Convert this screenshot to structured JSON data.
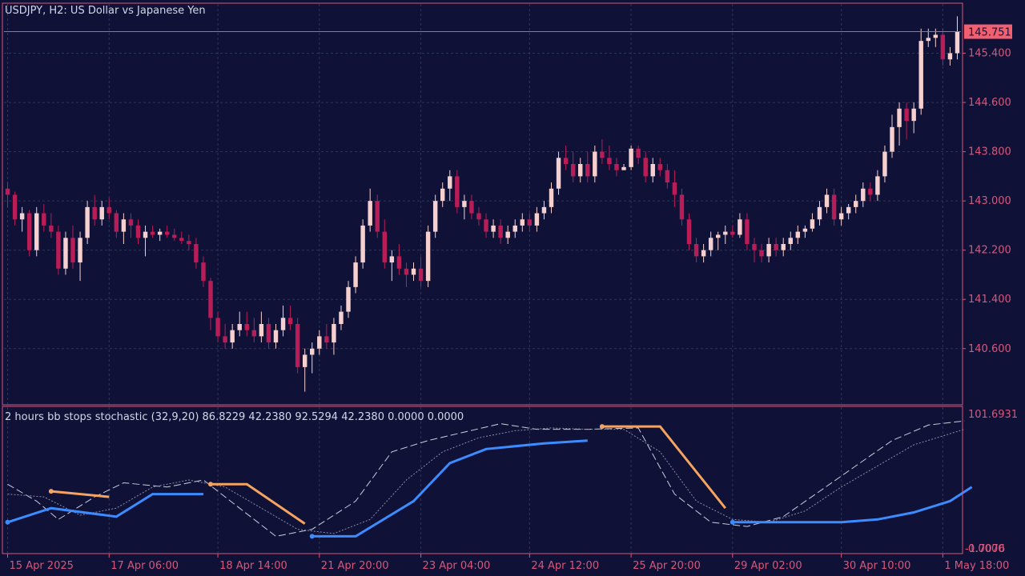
{
  "colors": {
    "background": "#0f1137",
    "frame": "#d8577a",
    "grid": "#2a3a55",
    "text": "#d8577a",
    "header_text": "#d0d8e8",
    "bull": "#f5d0cf",
    "bear": "#b81d57",
    "price_tag_bg": "#f06070",
    "price_tag_text": "#0f1137",
    "stop_up": "#3c8cff",
    "stop_down": "#f4a460",
    "stoch_main": "#c8d0dc",
    "stoch_signal": "#8a90a6"
  },
  "chart_data": [
    {
      "type": "candlestick",
      "title": "USDJPY, H2:  US Dollar vs Japanese Yen",
      "symbol": "USDJPY",
      "timeframe": "H2",
      "description": "US Dollar vs Japanese Yen",
      "current_price_label": "145.751",
      "current_price": 145.751,
      "ylim": [
        139.7,
        146.2
      ],
      "yticks": [
        140.6,
        141.4,
        142.2,
        143.0,
        143.8,
        144.6,
        145.4
      ],
      "ytick_labels": [
        "140.600",
        "141.400",
        "142.200",
        "143.000",
        "143.800",
        "144.600",
        "145.400"
      ],
      "grid": true,
      "candles": [
        [
          143.2,
          143.3,
          142.9,
          143.1
        ],
        [
          143.1,
          143.15,
          142.6,
          142.7
        ],
        [
          142.7,
          142.9,
          142.5,
          142.8
        ],
        [
          142.8,
          142.85,
          142.1,
          142.2
        ],
        [
          142.2,
          142.9,
          142.1,
          142.8
        ],
        [
          142.8,
          142.95,
          142.5,
          142.6
        ],
        [
          142.6,
          142.8,
          142.4,
          142.5
        ],
        [
          142.5,
          142.6,
          141.8,
          141.9
        ],
        [
          141.9,
          142.5,
          141.8,
          142.4
        ],
        [
          142.4,
          142.6,
          141.9,
          142.0
        ],
        [
          142.0,
          142.5,
          141.7,
          142.4
        ],
        [
          142.4,
          143.0,
          142.3,
          142.9
        ],
        [
          142.9,
          143.1,
          142.6,
          142.7
        ],
        [
          142.7,
          143.0,
          142.6,
          142.9
        ],
        [
          142.9,
          143.05,
          142.7,
          142.8
        ],
        [
          142.8,
          142.85,
          142.4,
          142.5
        ],
        [
          142.5,
          142.8,
          142.3,
          142.7
        ],
        [
          142.7,
          142.8,
          142.4,
          142.6
        ],
        [
          142.6,
          142.7,
          142.3,
          142.4
        ],
        [
          142.4,
          142.6,
          142.1,
          142.5
        ],
        [
          142.5,
          142.6,
          142.4,
          142.45
        ],
        [
          142.45,
          142.55,
          142.35,
          142.5
        ],
        [
          142.5,
          142.6,
          142.4,
          142.45
        ],
        [
          142.45,
          142.55,
          142.35,
          142.4
        ],
        [
          142.4,
          142.5,
          142.3,
          142.35
        ],
        [
          142.35,
          142.45,
          142.2,
          142.3
        ],
        [
          142.3,
          142.4,
          141.9,
          142.0
        ],
        [
          142.0,
          142.1,
          141.6,
          141.7
        ],
        [
          141.7,
          141.75,
          140.9,
          141.1
        ],
        [
          141.1,
          141.2,
          140.7,
          140.8
        ],
        [
          140.8,
          141.0,
          140.6,
          140.7
        ],
        [
          140.7,
          141.0,
          140.6,
          140.9
        ],
        [
          140.9,
          141.2,
          140.8,
          141.0
        ],
        [
          141.0,
          141.2,
          140.8,
          140.9
        ],
        [
          140.9,
          141.1,
          140.7,
          140.8
        ],
        [
          140.8,
          141.2,
          140.7,
          141.0
        ],
        [
          141.0,
          141.1,
          140.6,
          140.7
        ],
        [
          140.7,
          141.0,
          140.6,
          140.9
        ],
        [
          140.9,
          141.3,
          140.8,
          141.1
        ],
        [
          141.1,
          141.3,
          140.9,
          141.0
        ],
        [
          141.0,
          141.1,
          140.2,
          140.3
        ],
        [
          140.3,
          140.6,
          139.9,
          140.5
        ],
        [
          140.5,
          140.7,
          140.2,
          140.6
        ],
        [
          140.6,
          140.9,
          140.5,
          140.8
        ],
        [
          140.8,
          141.0,
          140.6,
          140.7
        ],
        [
          140.7,
          141.1,
          140.5,
          141.0
        ],
        [
          141.0,
          141.3,
          140.9,
          141.2
        ],
        [
          141.2,
          141.7,
          141.1,
          141.6
        ],
        [
          141.6,
          142.1,
          141.5,
          142.0
        ],
        [
          142.0,
          142.7,
          141.9,
          142.6
        ],
        [
          142.6,
          143.2,
          142.5,
          143.0
        ],
        [
          143.0,
          143.1,
          142.4,
          142.5
        ],
        [
          142.5,
          142.7,
          141.9,
          142.0
        ],
        [
          142.0,
          142.2,
          141.7,
          142.1
        ],
        [
          142.1,
          142.3,
          141.8,
          141.9
        ],
        [
          141.9,
          142.0,
          141.6,
          141.8
        ],
        [
          141.8,
          142.0,
          141.7,
          141.9
        ],
        [
          141.9,
          142.1,
          141.6,
          141.7
        ],
        [
          141.7,
          142.6,
          141.6,
          142.5
        ],
        [
          142.5,
          143.1,
          142.4,
          143.0
        ],
        [
          143.0,
          143.3,
          142.9,
          143.2
        ],
        [
          143.2,
          143.5,
          143.0,
          143.4
        ],
        [
          143.4,
          143.5,
          142.8,
          142.9
        ],
        [
          142.9,
          143.1,
          142.7,
          143.0
        ],
        [
          143.0,
          143.1,
          142.7,
          142.8
        ],
        [
          142.8,
          142.9,
          142.6,
          142.7
        ],
        [
          142.7,
          142.8,
          142.4,
          142.5
        ],
        [
          142.5,
          142.7,
          142.4,
          142.6
        ],
        [
          142.6,
          142.7,
          142.3,
          142.4
        ],
        [
          142.4,
          142.6,
          142.3,
          142.5
        ],
        [
          142.5,
          142.7,
          142.4,
          142.6
        ],
        [
          142.6,
          142.8,
          142.5,
          142.7
        ],
        [
          142.7,
          142.8,
          142.5,
          142.6
        ],
        [
          142.6,
          142.9,
          142.5,
          142.8
        ],
        [
          142.8,
          143.0,
          142.7,
          142.9
        ],
        [
          142.9,
          143.3,
          142.8,
          143.2
        ],
        [
          143.2,
          143.8,
          143.1,
          143.7
        ],
        [
          143.7,
          143.9,
          143.5,
          143.6
        ],
        [
          143.6,
          143.8,
          143.3,
          143.4
        ],
        [
          143.4,
          143.7,
          143.3,
          143.6
        ],
        [
          143.6,
          143.8,
          143.3,
          143.4
        ],
        [
          143.4,
          143.9,
          143.3,
          143.8
        ],
        [
          143.8,
          144.0,
          143.6,
          143.7
        ],
        [
          143.7,
          143.9,
          143.5,
          143.6
        ],
        [
          143.6,
          143.7,
          143.4,
          143.5
        ],
        [
          143.5,
          143.6,
          143.5,
          143.55
        ],
        [
          143.55,
          143.9,
          143.5,
          143.85
        ],
        [
          143.85,
          143.9,
          143.6,
          143.7
        ],
        [
          143.7,
          143.8,
          143.3,
          143.4
        ],
        [
          143.4,
          143.7,
          143.3,
          143.6
        ],
        [
          143.6,
          143.7,
          143.4,
          143.5
        ],
        [
          143.5,
          143.6,
          143.2,
          143.3
        ],
        [
          143.3,
          143.5,
          142.9,
          143.1
        ],
        [
          143.1,
          143.2,
          142.6,
          142.7
        ],
        [
          142.7,
          142.8,
          142.2,
          142.3
        ],
        [
          142.3,
          142.4,
          142.0,
          142.1
        ],
        [
          142.1,
          142.3,
          142.0,
          142.2
        ],
        [
          142.2,
          142.5,
          142.1,
          142.4
        ],
        [
          142.4,
          142.5,
          142.2,
          142.45
        ],
        [
          142.45,
          142.6,
          142.3,
          142.5
        ],
        [
          142.5,
          142.6,
          142.4,
          142.45
        ],
        [
          142.45,
          142.8,
          142.4,
          142.7
        ],
        [
          142.7,
          142.8,
          142.2,
          142.3
        ],
        [
          142.3,
          142.4,
          142.0,
          142.2
        ],
        [
          142.2,
          142.3,
          142.0,
          142.1
        ],
        [
          142.1,
          142.4,
          142.0,
          142.3
        ],
        [
          142.3,
          142.4,
          142.1,
          142.2
        ],
        [
          142.2,
          142.4,
          142.1,
          142.3
        ],
        [
          142.3,
          142.5,
          142.2,
          142.4
        ],
        [
          142.4,
          142.6,
          142.3,
          142.5
        ],
        [
          142.5,
          142.6,
          142.4,
          142.55
        ],
        [
          142.55,
          142.8,
          142.5,
          142.7
        ],
        [
          142.7,
          143.0,
          142.6,
          142.9
        ],
        [
          142.9,
          143.2,
          142.8,
          143.1
        ],
        [
          143.1,
          143.2,
          142.6,
          142.7
        ],
        [
          142.7,
          142.9,
          142.6,
          142.8
        ],
        [
          142.8,
          142.95,
          142.7,
          142.9
        ],
        [
          142.9,
          143.1,
          142.8,
          143.0
        ],
        [
          143.0,
          143.3,
          142.9,
          143.2
        ],
        [
          143.2,
          143.3,
          143.0,
          143.1
        ],
        [
          143.1,
          143.5,
          143.0,
          143.4
        ],
        [
          143.4,
          143.9,
          143.3,
          143.8
        ],
        [
          143.8,
          144.4,
          143.7,
          144.2
        ],
        [
          144.2,
          144.6,
          143.9,
          144.5
        ],
        [
          144.5,
          144.6,
          144.0,
          144.3
        ],
        [
          144.3,
          144.6,
          144.1,
          144.5
        ],
        [
          144.5,
          145.8,
          144.4,
          145.6
        ],
        [
          145.6,
          145.8,
          145.5,
          145.65
        ],
        [
          145.65,
          145.8,
          145.5,
          145.7
        ],
        [
          145.7,
          145.8,
          145.2,
          145.3
        ],
        [
          145.3,
          145.5,
          145.2,
          145.4
        ],
        [
          145.4,
          146.0,
          145.3,
          145.751
        ]
      ]
    },
    {
      "type": "line",
      "title": "2 hours bb stops stochastic (32,9,20) 86.8229 42.2380 92.5294 42.2380 0.0000 0.0000",
      "indicator_name": "2 hours bb stops stochastic",
      "params": "(32,9,20)",
      "readout": "86.8229 42.2380 92.5294 42.2380 0.0000 0.0000",
      "ylim": [
        -1.7,
        101.6931
      ],
      "ytick_labels": [
        "101.6931",
        "0.0000",
        "-1.7076"
      ],
      "series": [
        {
          "role": "stoch_main",
          "x": [
            0,
            4,
            7,
            12,
            16,
            22,
            27,
            32,
            37,
            42,
            48,
            53,
            58,
            63,
            68,
            73,
            80,
            87,
            92,
            97,
            102,
            107,
            112,
            117,
            122,
            127,
            132
          ],
          "values": [
            47,
            35,
            22,
            38,
            48,
            45,
            50,
            30,
            10,
            15,
            35,
            70,
            78,
            84,
            90,
            86,
            86,
            87,
            40,
            20,
            17,
            24,
            42,
            60,
            78,
            89,
            92
          ]
        },
        {
          "role": "stoch_signal",
          "x": [
            0,
            5,
            10,
            15,
            20,
            25,
            30,
            35,
            40,
            45,
            50,
            55,
            60,
            65,
            70,
            75,
            80,
            85,
            90,
            95,
            100,
            105,
            110,
            115,
            120,
            125,
            132
          ],
          "values": [
            40,
            38,
            25,
            30,
            45,
            50,
            45,
            30,
            15,
            12,
            22,
            50,
            70,
            80,
            85,
            87,
            86,
            86,
            70,
            35,
            22,
            20,
            28,
            45,
            60,
            75,
            86
          ]
        },
        {
          "role": "stop_up",
          "x": [
            0,
            6,
            15,
            20,
            27
          ],
          "values": [
            20,
            30,
            24,
            40,
            40
          ]
        },
        {
          "role": "stop_down",
          "x": [
            6,
            14
          ],
          "values": [
            42,
            38
          ]
        },
        {
          "role": "stop_down",
          "x": [
            28,
            33,
            41
          ],
          "values": [
            47,
            47,
            19
          ]
        },
        {
          "role": "stop_up",
          "x": [
            42,
            48,
            56,
            61,
            66,
            74,
            80
          ],
          "values": [
            10,
            10,
            35,
            62,
            72,
            76,
            78
          ]
        },
        {
          "role": "stop_down",
          "x": [
            82,
            90,
            99
          ],
          "values": [
            88,
            88,
            30
          ]
        },
        {
          "role": "stop_up",
          "x": [
            100,
            105,
            109,
            115,
            120,
            125,
            130,
            133
          ],
          "values": [
            20,
            20,
            20,
            20,
            22,
            27,
            35,
            45
          ]
        }
      ]
    }
  ],
  "xaxis": {
    "labels": [
      "15 Apr 2025",
      "17 Apr 06:00",
      "18 Apr 14:00",
      "21 Apr 20:00",
      "23 Apr 04:00",
      "24 Apr 12:00",
      "25 Apr 20:00",
      "29 Apr 02:00",
      "30 Apr 10:00",
      "1 May 18:00"
    ]
  }
}
